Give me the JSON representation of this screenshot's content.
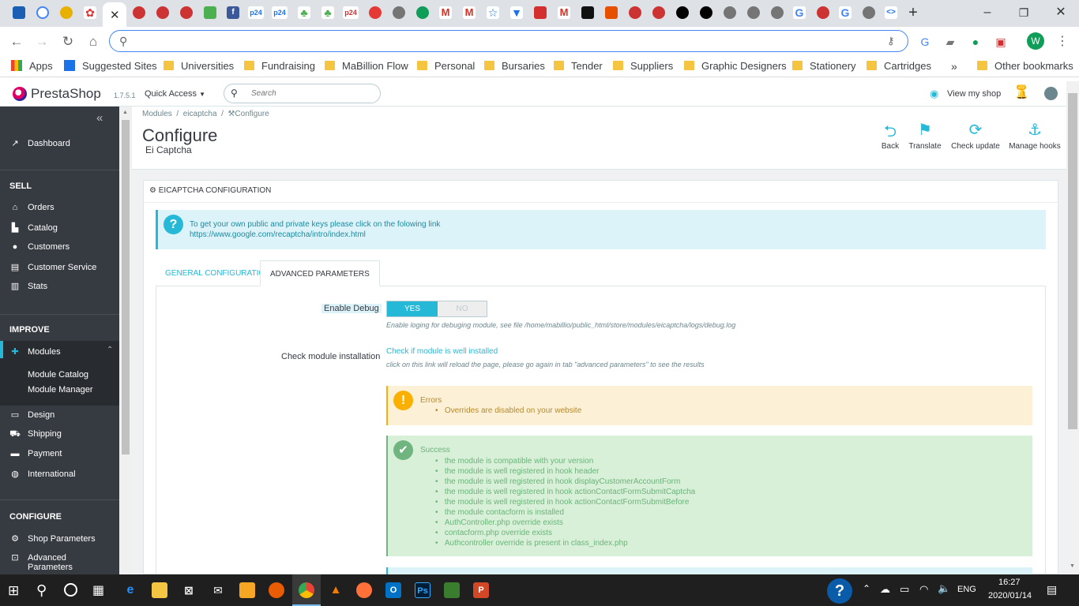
{
  "browser": {
    "bookmarks": [
      "Apps",
      "Suggested Sites",
      "Universities",
      "Fundraising",
      "MaBillion Flow",
      "Personal",
      "Bursaries",
      "Tender",
      "Suppliers",
      "Graphic Designers",
      "Stationery",
      "Cartridges",
      "Other bookmarks"
    ],
    "more_bookmarks": "»",
    "profile_initial": "W",
    "tab_glyphs": [
      "p24",
      "p24",
      "p24",
      "M",
      "M",
      "M",
      "G",
      "G"
    ]
  },
  "ps": {
    "logo_text": "PrestaShop",
    "version": "1.7.5.1",
    "quick_access": "Quick Access",
    "search_placeholder": "Search",
    "view_shop": "View my shop",
    "notif_count": "20"
  },
  "sidebar": {
    "collapse": "«",
    "dashboard": "Dashboard",
    "sell": "SELL",
    "orders": "Orders",
    "catalog": "Catalog",
    "customers": "Customers",
    "customer_service": "Customer Service",
    "stats": "Stats",
    "improve": "IMPROVE",
    "modules": "Modules",
    "module_catalog": "Module Catalog",
    "module_manager": "Module Manager",
    "design": "Design",
    "shipping": "Shipping",
    "payment": "Payment",
    "international": "International",
    "configure": "CONFIGURE",
    "shop_parameters": "Shop Parameters",
    "advanced_parameters_1": "Advanced",
    "advanced_parameters_2": "Parameters"
  },
  "page": {
    "breadcrumb_1": "Modules",
    "breadcrumb_2": "eicaptcha",
    "breadcrumb_3": "Configure",
    "title": "Configure",
    "subtitle": "Ei Captcha",
    "toolbar": {
      "back": "Back",
      "translate": "Translate",
      "check_update": "Check update",
      "manage_hooks": "Manage hooks"
    }
  },
  "panel": {
    "heading": "EICAPTCHA CONFIGURATION",
    "info_text": "To get your own public and private keys please click on the folowing link",
    "info_link": "https://www.google.com/recaptcha/intro/index.html",
    "tab_general": "GENERAL CONFIGURATION",
    "tab_advanced": "ADVANCED PARAMETERS",
    "debug_label": "Enable Debug",
    "debug_yes": "YES",
    "debug_no": "NO",
    "debug_help": "Enable loging for debuging module, see file /home/mabillio/public_html/store/modules/eicaptcha/logs/debug.log",
    "check_label": "Check module installation",
    "check_link": "Check if module is well installed",
    "check_help": "click on this link will reload the page, please go again in tab \"advanced parameters\" to see the results",
    "errors_title": "Errors",
    "errors": [
      "Overrides are disabled on your website"
    ],
    "success_title": "Success",
    "success": [
      "the module is compatible with your version",
      "the module is well registered in hook header",
      "the module is well registered in hook displayCustomerAccountForm",
      "the module is well registered in hook actionContactFormSubmitCaptcha",
      "the module is well registered in hook actionContactFormSubmitBefore",
      "the module contacform is installed",
      "AuthController.php override exists",
      "contacform.php override exists",
      "Authcontroller override is present in class_index.php"
    ]
  },
  "taskbar": {
    "lang": "ENG",
    "time": "16:27",
    "date": "2020/01/14"
  }
}
